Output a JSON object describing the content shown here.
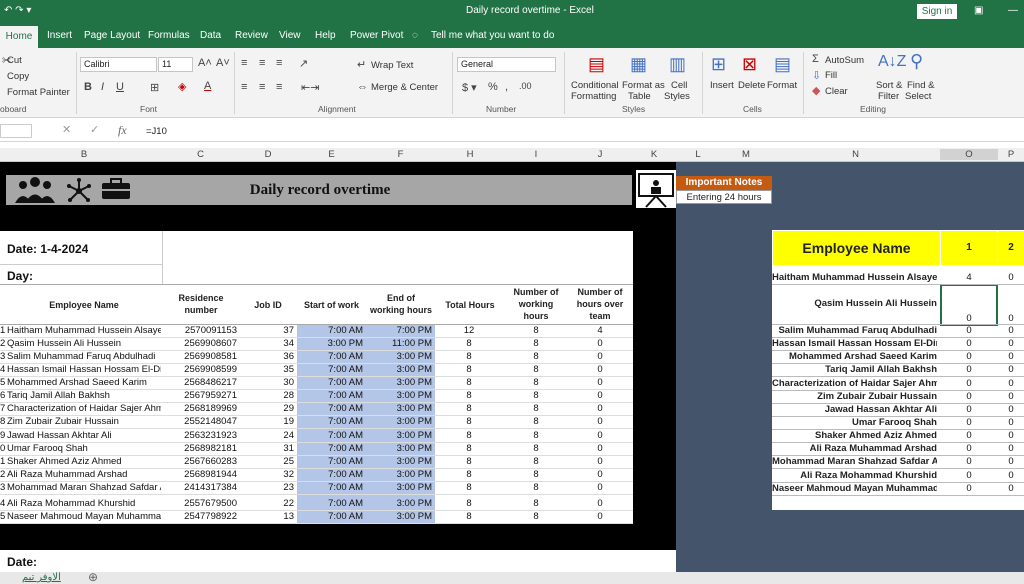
{
  "app": {
    "title": "Daily record overtime  -  Excel",
    "signin": "Sign in"
  },
  "tabs": [
    "Home",
    "Insert",
    "Page Layout",
    "Formulas",
    "Data",
    "Review",
    "View",
    "Help",
    "Power Pivot",
    "Tell me what you want to do"
  ],
  "ribbon": {
    "clipboard": {
      "cut": "Cut",
      "copy": "Copy",
      "painter": "Format Painter",
      "label": "oboard"
    },
    "font": {
      "name": "Calibri",
      "size": "11",
      "label": "Font"
    },
    "alignment": {
      "wrap": "Wrap Text",
      "merge": "Merge & Center",
      "label": "Alignment"
    },
    "number": {
      "format": "General",
      "label": "Number"
    },
    "styles": {
      "cond": "Conditional",
      "cond2": "Formatting",
      "fmt": "Format as",
      "fmt2": "Table",
      "cell": "Cell",
      "cell2": "Styles",
      "label": "Styles"
    },
    "cells": {
      "insert": "Insert",
      "delete": "Delete",
      "format": "Format",
      "label": "Cells"
    },
    "editing": {
      "autosum": "AutoSum",
      "fill": "Fill",
      "clear": "Clear",
      "sort": "Sort &",
      "sort2": "Filter",
      "find": "Find &",
      "find2": "Select",
      "label": "Editing"
    }
  },
  "formula": "=J10",
  "columns": [
    "B",
    "C",
    "D",
    "E",
    "F",
    "H",
    "I",
    "J",
    "K",
    "L",
    "M",
    "N",
    "O",
    "P"
  ],
  "sheet": {
    "title": "Daily record overtime",
    "notes_title": "Important Notes",
    "notes_text": "Entering 24 hours",
    "date": "Date: 1-4-2024",
    "day": "Day:",
    "date2": "Date:",
    "headers": [
      "Employee Name",
      "Residence number",
      "Job ID",
      "Start of work",
      "End of working hours",
      "Total Hours",
      "Number of working hours",
      "Number of hours over team"
    ],
    "row_prefix": [
      "1",
      "2",
      "3",
      "4",
      "5",
      "6",
      "7",
      "8",
      "9",
      "0",
      "1",
      "2",
      "3",
      "4",
      "5"
    ],
    "rows": [
      [
        "Haitham Muhammad Hussein Alsaye",
        "2570091153",
        "37",
        "7:00 AM",
        "7:00 PM",
        "12",
        "8",
        "4"
      ],
      [
        "Qasim Hussein Ali Hussein",
        "2569908607",
        "34",
        "3:00 PM",
        "11:00 PM",
        "8",
        "8",
        "0"
      ],
      [
        "Salim Muhammad Faruq Abdulhadi",
        "2569908581",
        "36",
        "7:00 AM",
        "3:00 PM",
        "8",
        "8",
        "0"
      ],
      [
        "Hassan Ismail Hassan Hossam El-Din",
        "2569908599",
        "35",
        "7:00 AM",
        "3:00 PM",
        "8",
        "8",
        "0"
      ],
      [
        "Mohammed Arshad Saeed Karim",
        "2568486217",
        "30",
        "7:00 AM",
        "3:00 PM",
        "8",
        "8",
        "0"
      ],
      [
        "Tariq Jamil Allah Bakhsh",
        "2567959271",
        "28",
        "7:00 AM",
        "3:00 PM",
        "8",
        "8",
        "0"
      ],
      [
        "Characterization of Haidar Sajer Ahme",
        "2568189969",
        "29",
        "7:00 AM",
        "3:00 PM",
        "8",
        "8",
        "0"
      ],
      [
        "Zim Zubair Zubair Hussain",
        "2552148047",
        "19",
        "7:00 AM",
        "3:00 PM",
        "8",
        "8",
        "0"
      ],
      [
        "Jawad Hassan Akhtar Ali",
        "2563231923",
        "24",
        "7:00 AM",
        "3:00 PM",
        "8",
        "8",
        "0"
      ],
      [
        "Umar Farooq Shah",
        "2568982181",
        "31",
        "7:00 AM",
        "3:00 PM",
        "8",
        "8",
        "0"
      ],
      [
        "Shaker Ahmed Aziz Ahmed",
        "2567660283",
        "25",
        "7:00 AM",
        "3:00 PM",
        "8",
        "8",
        "0"
      ],
      [
        "Ali Raza Muhammad Arshad",
        "2568981944",
        "32",
        "7:00 AM",
        "3:00 PM",
        "8",
        "8",
        "0"
      ],
      [
        "Mohammad Maran Shahzad Safdar A",
        "2414317384",
        "23",
        "7:00 AM",
        "3:00 PM",
        "8",
        "8",
        "0"
      ],
      [
        "Ali Raza Mohammad Khurshid",
        "2557679500",
        "22",
        "7:00 AM",
        "3:00 PM",
        "8",
        "8",
        "0"
      ],
      [
        "Naseer Mahmoud Mayan Muhamma",
        "2547798922",
        "13",
        "7:00 AM",
        "3:00 PM",
        "8",
        "8",
        "0"
      ]
    ],
    "right_header": "Employee Name",
    "right_cols": [
      "1",
      "2"
    ],
    "right_rows": [
      [
        "Haitham Muhammad Hussein Alsayed",
        "4",
        "0"
      ],
      [
        "Qasim Hussein Ali Hussein",
        "0",
        "0"
      ],
      [
        "Salim Muhammad Faruq Abdulhadi",
        "0",
        "0"
      ],
      [
        "Hassan Ismail Hassan Hossam El-Din",
        "0",
        "0"
      ],
      [
        "Mohammed Arshad Saeed Karim",
        "0",
        "0"
      ],
      [
        "Tariq Jamil Allah Bakhsh",
        "0",
        "0"
      ],
      [
        "Characterization of Haidar Sajer Ahmed",
        "0",
        "0"
      ],
      [
        "Zim Zubair Zubair Hussain",
        "0",
        "0"
      ],
      [
        "Jawad Hassan Akhtar Ali",
        "0",
        "0"
      ],
      [
        "Umar Farooq Shah",
        "0",
        "0"
      ],
      [
        "Shaker Ahmed Aziz Ahmed",
        "0",
        "0"
      ],
      [
        "Ali Raza Muhammad Arshad",
        "0",
        "0"
      ],
      [
        "Mohammad Maran Shahzad Safdar Ali",
        "0",
        "0"
      ],
      [
        "Ali Raza Mohammad Khurshid",
        "0",
        "0"
      ],
      [
        "Naseer Mahmoud Mayan Muhammad",
        "0",
        "0"
      ]
    ],
    "tab_name": "الاوفر تيم"
  },
  "colors": {
    "accent": "#217346",
    "blue_cell": "#b4c6e7",
    "yellow": "#ffff00",
    "notes_orange": "#c55a11",
    "panel": "#44546a"
  }
}
